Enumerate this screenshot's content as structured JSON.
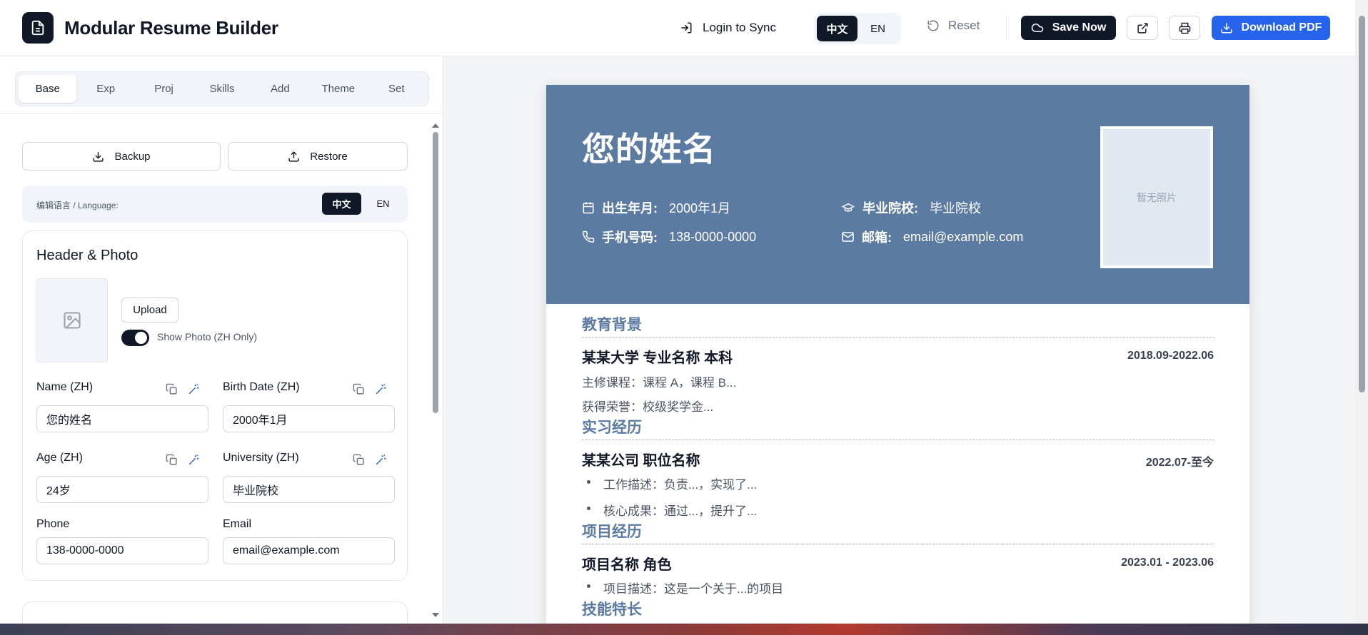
{
  "header": {
    "app_title": "Modular Resume Builder",
    "login_label": "Login to Sync",
    "lang_options": [
      "中文",
      "EN"
    ],
    "lang_selected": "中文",
    "reset_label": "Reset",
    "save_label": "Save Now",
    "download_label": "Download PDF"
  },
  "sidebar": {
    "tabs": [
      "Base",
      "Exp",
      "Proj",
      "Skills",
      "Add",
      "Theme",
      "Set"
    ],
    "active_tab": "Base",
    "backup_label": "Backup",
    "restore_label": "Restore",
    "edit_language_label": "编辑语言 / Language:",
    "edit_lang_options": [
      "中文",
      "EN"
    ],
    "edit_lang_selected": "中文"
  },
  "header_card": {
    "title": "Header & Photo",
    "upload_label": "Upload",
    "show_photo_label": "Show Photo (ZH Only)",
    "show_photo_on": true,
    "fields": {
      "name_label": "Name (ZH)",
      "name_value": "您的姓名",
      "birth_label": "Birth Date (ZH)",
      "birth_value": "2000年1月",
      "age_label": "Age (ZH)",
      "age_value": "24岁",
      "university_label": "University (ZH)",
      "university_value": "毕业院校",
      "phone_label": "Phone",
      "phone_value": "138-0000-0000",
      "email_label": "Email",
      "email_value": "email@example.com"
    }
  },
  "resume": {
    "name": "您的姓名",
    "birth_key": "出生年月:",
    "birth_value": "2000年1月",
    "school_key": "毕业院校:",
    "school_value": "毕业院校",
    "phone_key": "手机号码:",
    "phone_value": "138-0000-0000",
    "email_key": "邮箱:",
    "email_value": "email@example.com",
    "photo_placeholder": "暂无照片",
    "education": {
      "title": "教育背景",
      "entry_title": "某某大学 专业名称 本科",
      "date": "2018.09-2022.06",
      "courses": "主修课程：课程 A，课程 B...",
      "honors": "获得荣誉：校级奖学金..."
    },
    "internship": {
      "title": "实习经历",
      "entry_title": "某某公司 职位名称",
      "date": "2022.07-至今",
      "bullets": [
        "工作描述：负责...，实现了...",
        "核心成果：通过...，提升了..."
      ]
    },
    "projects": {
      "title": "项目经历",
      "entry_title": "项目名称 角色",
      "date": "2023.01 - 2023.06",
      "bullets": [
        "项目描述：这是一个关于...的项目"
      ]
    },
    "skills": {
      "title": "技能特长"
    }
  },
  "colors": {
    "accent_dark": "#111827",
    "primary_blue": "#2563eb",
    "resume_header": "#5b7ba3"
  }
}
